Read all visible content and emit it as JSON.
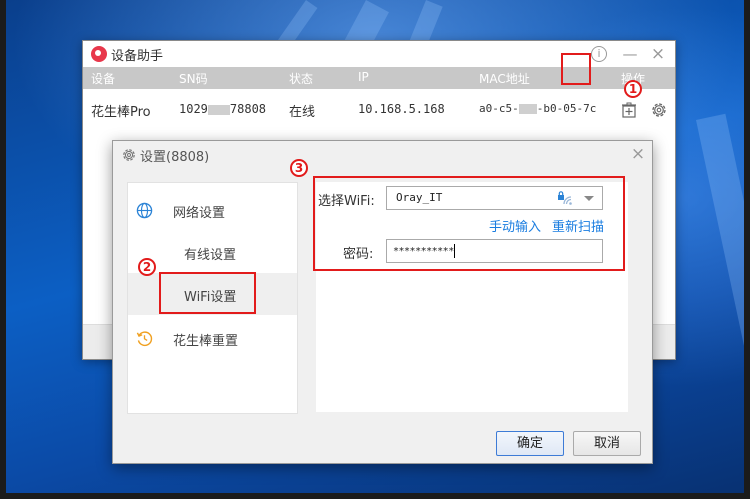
{
  "main_window": {
    "title": "设备助手",
    "info_glyph": "i",
    "minimize_glyph": "—",
    "close_glyph": "×",
    "columns": [
      "设备",
      "SN码",
      "状态",
      "IP",
      "MAC地址",
      "操作"
    ],
    "device": {
      "name": "花生棒Pro",
      "sn_prefix": "1029",
      "sn_suffix": "78808",
      "status": "在线",
      "ip": "10.168.5.168",
      "mac_prefix": "a0-c5-",
      "mac_suffix": "-b0-05-7c"
    }
  },
  "settings_dialog": {
    "title": "设置(8808)",
    "close_glyph": "×",
    "nav": {
      "network": "网络设置",
      "wired": "有线设置",
      "wifi": "WiFi设置",
      "reset": "花生棒重置"
    },
    "form": {
      "wifi_label": "选择WiFi:",
      "wifi_value": "Oray_IT",
      "manual_input_link": "手动输入",
      "rescan_link": "重新扫描",
      "password_label": "密码:",
      "password_value": "***********"
    },
    "confirm_label": "确定",
    "cancel_label": "取消"
  },
  "annotations": {
    "badge_1": "1",
    "badge_2": "2",
    "badge_3": "3",
    "highlight_color": "#e21b1b"
  },
  "icons": [
    "app-logo",
    "info-icon",
    "delete-icon",
    "gear-icon",
    "globe-icon",
    "reset-icon",
    "lock-wifi-icon",
    "chevron-down-icon"
  ]
}
